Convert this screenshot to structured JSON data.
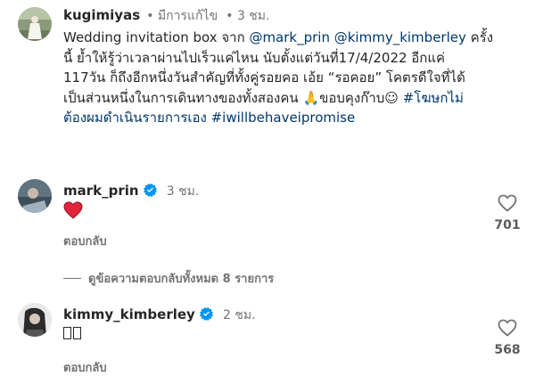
{
  "caption": {
    "username": "kugimiyas",
    "edited": "• มีการแก้ไข",
    "time": "• 3 ชม.",
    "lines": [
      {
        "pre": "Wedding invitation box จาก ",
        "m1": "@mark_prin",
        "mid": " ",
        "m2": "@kimmy_kimberley",
        "post": " ครั้ง"
      },
      {
        "text": "นี้ ย้ำให้รู้ว่าเวลาผ่านไปเร็วแค่ไหน นับตั้งแต่วันที่17/4/2022 อีกแค่"
      },
      {
        "text": "117วัน ก็ถึงอีกหนึ่งวันสำคัญที่ทั้งคู่รอยคอ เอ้ย “รอคอย” โคตรดีใจที่ได้"
      },
      {
        "pre": "เป็นส่วนหนึ่งในการเดินทางของทั้งสองคน 🙏ขอบคุงก๊าบ☺ ",
        "tag": "#โฆษกไม่"
      },
      {
        "tag": "ต้องผมดำเนินรายการเอง #iwillbehaveipromise"
      }
    ]
  },
  "comments": [
    {
      "username": "mark_prin",
      "time": "3 ชม.",
      "text": "❤",
      "reply_label": "ตอบกลับ",
      "like_count": "701"
    },
    {
      "username": "kimmy_kimberley",
      "time": "2 ชม.",
      "text": "",
      "reply_label": "ตอบกลับ",
      "like_count": "568"
    }
  ],
  "view_replies": "ดูข้อความตอบกลับทั้งหมด 8 รายการ",
  "icons": {
    "verified": "verified-badge-icon",
    "heart": "heart-outline-icon",
    "heart_filled": "heart-filled-icon"
  },
  "colors": {
    "link": "#00376b",
    "verified": "#0095f6",
    "heart": "#ed4956",
    "muted": "#737373"
  }
}
